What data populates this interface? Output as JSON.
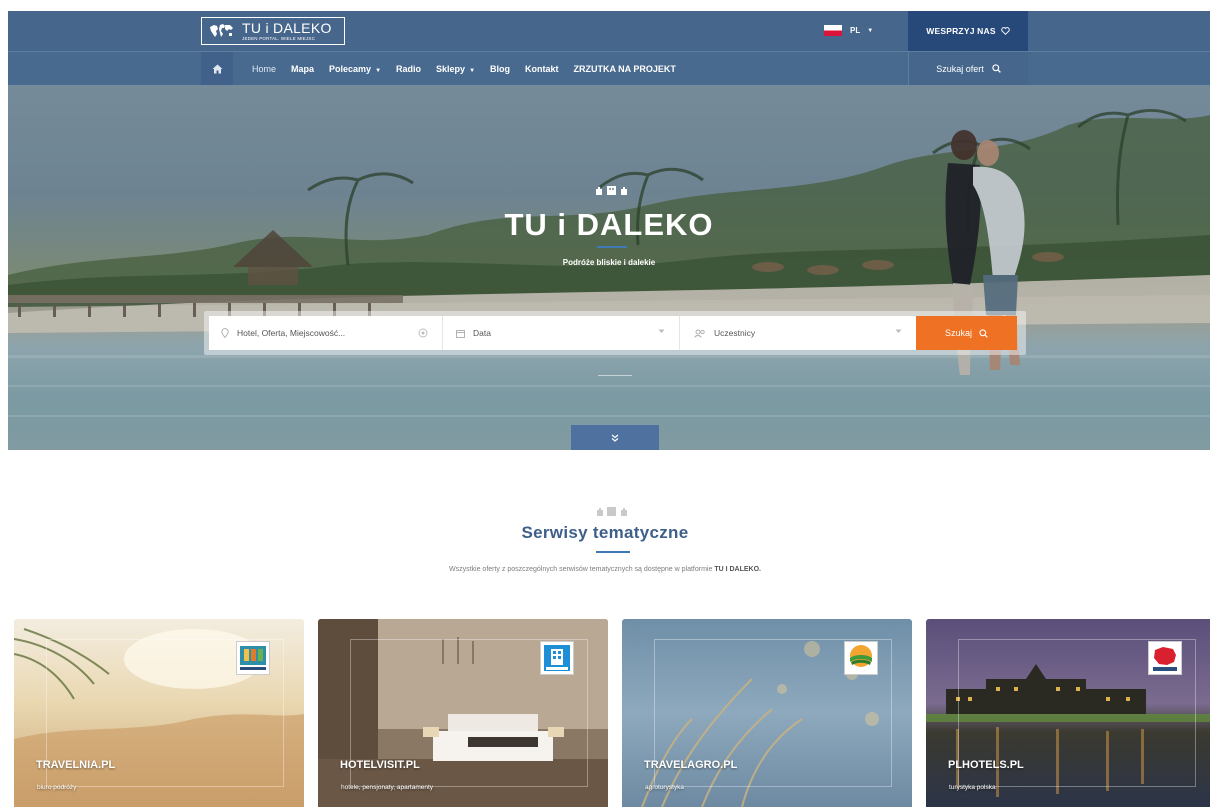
{
  "header": {
    "logo_name": "TU i DALEKO",
    "logo_tagline": "JEDEN PORTAL. WIELE MIEJSC",
    "language": "PL",
    "support_label": "WESPRZYJ NAS"
  },
  "nav": {
    "items": [
      {
        "label": "Home",
        "has_dropdown": false
      },
      {
        "label": "Mapa",
        "has_dropdown": false
      },
      {
        "label": "Polecamy",
        "has_dropdown": true
      },
      {
        "label": "Radio",
        "has_dropdown": false
      },
      {
        "label": "Sklepy",
        "has_dropdown": true
      },
      {
        "label": "Blog",
        "has_dropdown": false
      },
      {
        "label": "Kontakt",
        "has_dropdown": false
      },
      {
        "label": "ZRZUTKA NA PROJEKT",
        "has_dropdown": false
      }
    ],
    "search_label": "Szukaj ofert"
  },
  "hero": {
    "title": "TU i DALEKO",
    "subtitle": "Podróże bliskie i dalekie"
  },
  "search": {
    "location_placeholder": "Hotel, Oferta, Miejscowość...",
    "date_label": "Data",
    "guests_label": "Uczestnicy",
    "button_label": "Szukaj"
  },
  "section": {
    "title": "Serwisy tematyczne",
    "description": "Wszystkie oferty z poszczególnych serwisów tematycznych są dostępne w platformie",
    "description_strong": "TU I DALEKO."
  },
  "cards": [
    {
      "name": "TRAVELNIA.PL",
      "subtitle": "biuro podróży"
    },
    {
      "name": "HOTELVISIT.PL",
      "subtitle": "hotele, pensjonaty, apartamenty"
    },
    {
      "name": "TRAVELAGRO.PL",
      "subtitle": "agroturystyka"
    },
    {
      "name": "PLHOTELS.PL",
      "subtitle": "turystyka polska"
    }
  ],
  "colors": {
    "header_bg": "#46668c",
    "support_bg": "#26497a",
    "accent_orange": "#ee7124",
    "title_blue": "#3e5f8a"
  },
  "icons": [
    "world-map-icon",
    "home-icon",
    "heart-icon",
    "search-icon",
    "pin-icon",
    "locate-icon",
    "calendar-icon",
    "users-icon",
    "double-chevron-down-icon",
    "buildings-icon"
  ]
}
